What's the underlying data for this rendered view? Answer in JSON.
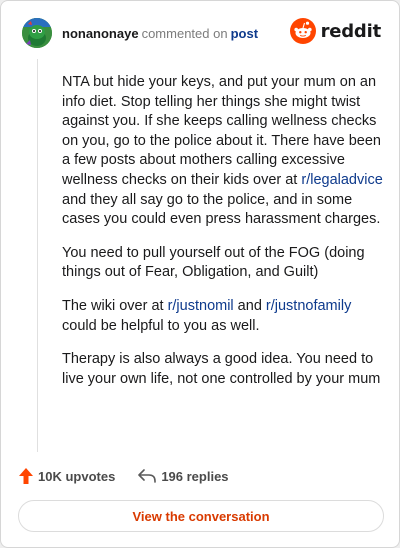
{
  "header": {
    "author": "nonanonaye",
    "action_text": "commented on",
    "post_link": "post",
    "brand": "reddit",
    "avatar_icon": "snoo-avatar-icon",
    "brand_icon": "reddit-snoo-logo-icon"
  },
  "comment": {
    "p1_a": "NTA but hide your keys, and put your mum on an info diet. Stop telling her things she might twist against you. If she keeps calling wellness checks on you, go to the police about it. There have been a few posts about mothers calling excessive wellness checks on their kids over at ",
    "p1_link": "r/legaladvice",
    "p1_b": " and they all say go to the police, and in some cases you could even press harassment charges.",
    "p2": "You need to pull yourself out of the FOG (doing things out of Fear, Obligation, and Guilt)",
    "p3_a": "The wiki over at ",
    "p3_link1": "r/justnomil",
    "p3_mid": " and ",
    "p3_link2": "r/justnofamily",
    "p3_b": " could be helpful to you as well.",
    "p4": "Therapy is also always a good idea. You need to live your own life, not one controlled by your mum"
  },
  "footer": {
    "upvotes": "10K upvotes",
    "replies": "196 replies",
    "view_button": "View the conversation",
    "upvote_icon": "upvote-arrow-icon",
    "reply_icon": "reply-arrow-icon"
  },
  "colors": {
    "accent": "#ff4500",
    "link": "#0e3a8c",
    "button_text": "#d93a00"
  }
}
